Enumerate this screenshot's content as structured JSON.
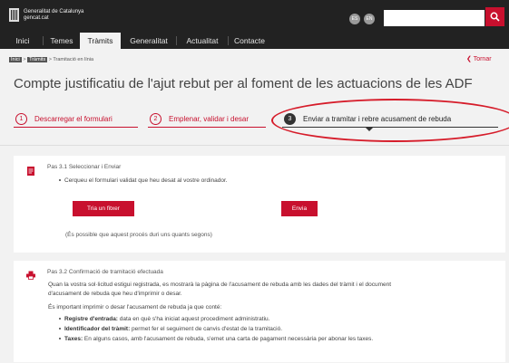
{
  "header": {
    "logo_line1": "Generalitat de Catalunya",
    "logo_line2": "gencat.cat",
    "lang_es": "ES",
    "lang_en": "EN",
    "search_value": ""
  },
  "nav": [
    {
      "label": "Inici"
    },
    {
      "label": "Temes"
    },
    {
      "label": "Tràmits"
    },
    {
      "label": "Generalitat"
    },
    {
      "label": "Actualitat"
    },
    {
      "label": "Contacte"
    }
  ],
  "breadcrumb": {
    "item1": "Inici",
    "sep1": ">",
    "item2": "Tràmits",
    "sep2": ">",
    "item3": "Tramitació en línia"
  },
  "back_label": "Tornar",
  "page_title": "Compte justificatiu de l'ajut rebut per al foment de les actuacions de les ADF",
  "steps": [
    {
      "num": "1",
      "label": "Descarregar el formulari"
    },
    {
      "num": "2",
      "label": "Emplenar, validar i desar"
    },
    {
      "num": "3",
      "label": "Enviar a tramitar i rebre acusament de rebuda"
    }
  ],
  "card1": {
    "title": "Pas 3.1 Seleccionar i Enviar",
    "bullet": "Cerqueu el formulari validat que heu desat al vostre ordinador.",
    "choose_file_label": "Tria un fitxer",
    "file_value": "",
    "send_label": "Envia",
    "note": "(És possible que aquest procés duri uns quants segons)"
  },
  "card2": {
    "title": "Pas 3.2 Confirmació de tramitació efectuada",
    "para1_line1": "Quan la vostra sol·licitud estigui registrada, es mostrarà la pàgina de l'acusament de rebuda amb les dades del tràmit i el document",
    "para1_line2": "d'acusament de rebuda que heu d'imprimir o desar.",
    "para2": "És important imprimir o desar l'acusament de rebuda ja que conté:",
    "items": [
      {
        "term": "Registre d'entrada:",
        "text": " data en què s'ha iniciat aquest procediment administratiu."
      },
      {
        "term": "Identificador del tràmit:",
        "text": " permet fer el seguiment de canvis d'estat de la tramitació."
      },
      {
        "term": "Taxes:",
        "text": " En alguns casos, amb l'acusament de rebuda, s'emet una carta de pagament necessària per abonar les taxes."
      }
    ]
  },
  "colors": {
    "accent": "#c8102e",
    "header_bg": "#222222",
    "page_bg": "#f2f2f2",
    "annotation": "#d61c2a"
  }
}
